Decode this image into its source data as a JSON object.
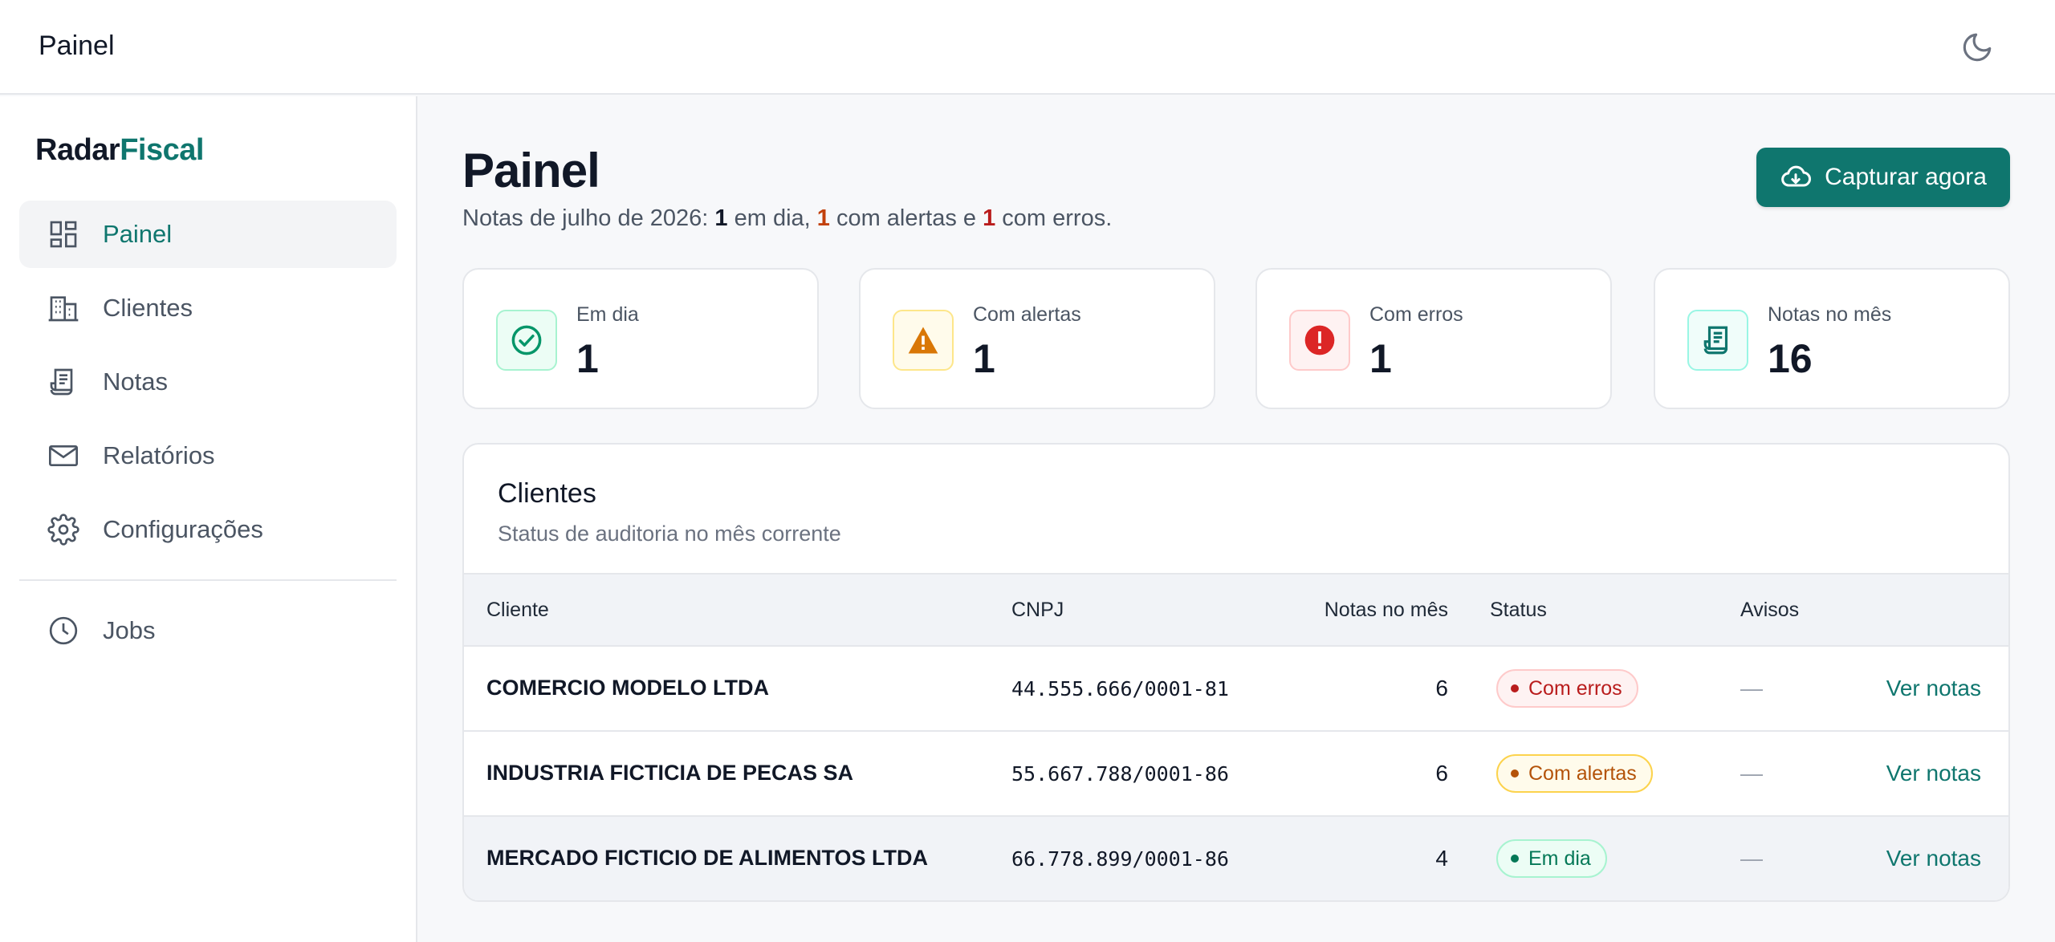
{
  "topbar": {
    "title": "Painel",
    "theme_icon": "moon-icon"
  },
  "brand": {
    "part1": "Radar",
    "part2": "Fiscal"
  },
  "sidebar": {
    "items": [
      {
        "label": "Painel",
        "icon": "dashboard-icon",
        "active": true
      },
      {
        "label": "Clientes",
        "icon": "building-icon"
      },
      {
        "label": "Notas",
        "icon": "receipt-icon"
      },
      {
        "label": "Relatórios",
        "icon": "mail-icon"
      },
      {
        "label": "Configurações",
        "icon": "gear-icon"
      }
    ],
    "secondary": [
      {
        "label": "Jobs",
        "icon": "clock-icon"
      }
    ]
  },
  "header": {
    "title": "Painel",
    "subtitle": {
      "prefix": "Notas de julho de 2026: ",
      "ok_count": "1",
      "ok_text": " em dia, ",
      "warn_count": "1",
      "warn_text": " com alertas e ",
      "err_count": "1",
      "err_text": " com erros."
    },
    "capture_button": "Capturar agora"
  },
  "stats": [
    {
      "label": "Em dia",
      "value": "1",
      "icon": "check-circle-icon",
      "color": "#059669"
    },
    {
      "label": "Com alertas",
      "value": "1",
      "icon": "warning-icon",
      "color": "#d97706"
    },
    {
      "label": "Com erros",
      "value": "1",
      "icon": "error-icon",
      "color": "#dc2626"
    },
    {
      "label": "Notas no mês",
      "value": "16",
      "icon": "receipt-icon",
      "color": "#0f766e"
    }
  ],
  "clients": {
    "title": "Clientes",
    "subtitle": "Status de auditoria no mês corrente",
    "columns": [
      "Cliente",
      "CNPJ",
      "Notas no mês",
      "Status",
      "Avisos"
    ],
    "rows": [
      {
        "name": "COMERCIO MODELO LTDA",
        "cnpj": "44.555.666/0001-81",
        "count": "6",
        "status": "Com erros",
        "status_type": "err",
        "warnings": "—",
        "action": "Ver notas"
      },
      {
        "name": "INDUSTRIA FICTICIA DE PECAS SA",
        "cnpj": "55.667.788/0001-86",
        "count": "6",
        "status": "Com alertas",
        "status_type": "warn",
        "warnings": "—",
        "action": "Ver notas"
      },
      {
        "name": "MERCADO FICTICIO DE ALIMENTOS LTDA",
        "cnpj": "66.778.899/0001-86",
        "count": "4",
        "status": "Em dia",
        "status_type": "ok",
        "warnings": "—",
        "action": "Ver notas"
      }
    ]
  },
  "colors": {
    "accent": "#0f766e",
    "error": "#b91c1c",
    "warning": "#b45309",
    "success": "#047857"
  }
}
